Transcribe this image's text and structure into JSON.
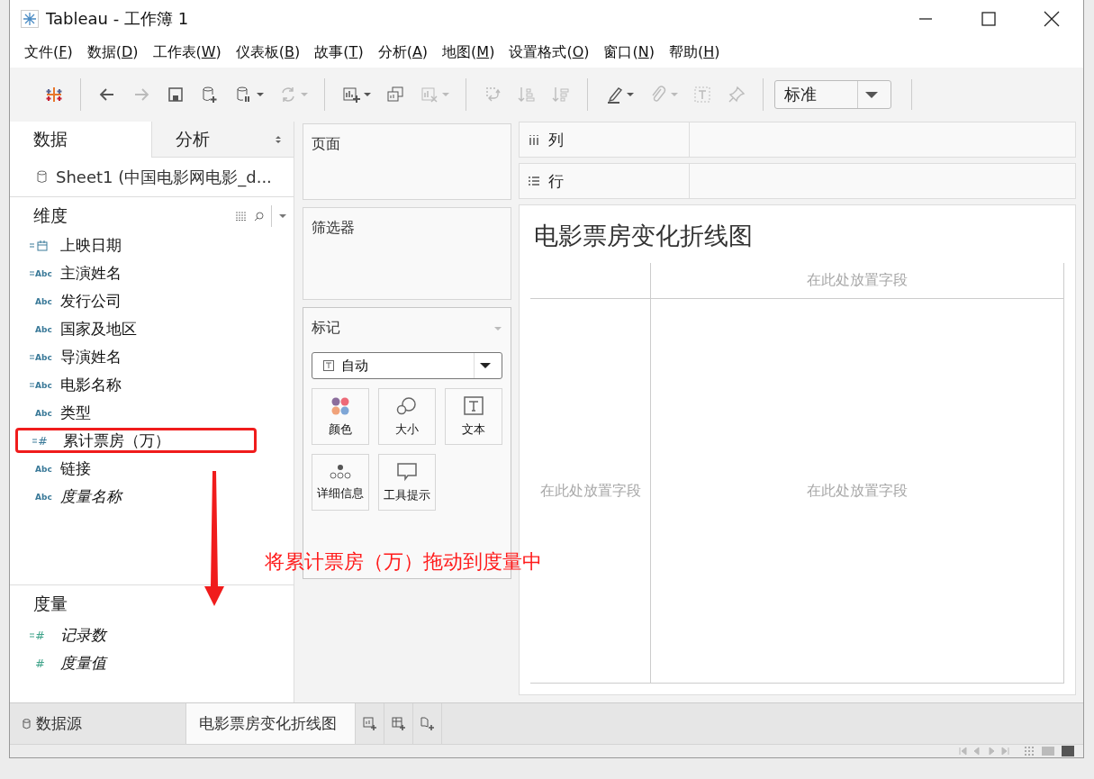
{
  "window": {
    "title": "Tableau - 工作簿 1"
  },
  "menu": [
    {
      "label": "文件(F)"
    },
    {
      "label": "数据(D)"
    },
    {
      "label": "工作表(W)"
    },
    {
      "label": "仪表板(B)"
    },
    {
      "label": "故事(T)"
    },
    {
      "label": "分析(A)"
    },
    {
      "label": "地图(M)"
    },
    {
      "label": "设置格式(O)"
    },
    {
      "label": "窗口(N)"
    },
    {
      "label": "帮助(H)"
    }
  ],
  "toolbar": {
    "groups": [
      [
        {
          "kind": "logo",
          "disabled": false,
          "dropdown": false
        }
      ],
      [
        {
          "kind": "undo",
          "disabled": false,
          "dropdown": false
        },
        {
          "kind": "redo",
          "disabled": true,
          "dropdown": false
        },
        {
          "kind": "save",
          "disabled": false,
          "dropdown": false
        },
        {
          "kind": "new-datasource",
          "disabled": false,
          "dropdown": false
        },
        {
          "kind": "pause-datasource",
          "disabled": false,
          "dropdown": true
        },
        {
          "kind": "refresh",
          "disabled": true,
          "dropdown": true
        }
      ],
      [
        {
          "kind": "new-sheet",
          "disabled": false,
          "dropdown": true
        },
        {
          "kind": "duplicate",
          "disabled": false,
          "dropdown": false
        },
        {
          "kind": "clear",
          "disabled": true,
          "dropdown": true
        }
      ],
      [
        {
          "kind": "swap",
          "disabled": true,
          "dropdown": false
        },
        {
          "kind": "sort-asc",
          "disabled": true,
          "dropdown": false
        },
        {
          "kind": "sort-desc",
          "disabled": true,
          "dropdown": false
        }
      ],
      [
        {
          "kind": "highlight",
          "disabled": false,
          "dropdown": true
        },
        {
          "kind": "group",
          "disabled": true,
          "dropdown": true
        },
        {
          "kind": "label",
          "disabled": true,
          "dropdown": false
        },
        {
          "kind": "pin",
          "disabled": true,
          "dropdown": false
        }
      ]
    ],
    "fit": "标准"
  },
  "side_tabs": [
    {
      "label": "数据",
      "selected": true
    },
    {
      "label": "分析",
      "selected": false
    }
  ],
  "datasource": "Sheet1 (中国电影网电影_d...",
  "dimensions": {
    "title": "维度",
    "fields": [
      {
        "name": "上映日期",
        "kind": "date",
        "derived": true,
        "generated": false,
        "highlighted": false
      },
      {
        "name": "主演姓名",
        "kind": "string",
        "type_label": "Abc",
        "derived": true,
        "generated": false,
        "highlighted": false
      },
      {
        "name": "发行公司",
        "kind": "string",
        "type_label": "Abc",
        "derived": false,
        "generated": false,
        "highlighted": false
      },
      {
        "name": "国家及地区",
        "kind": "string",
        "type_label": "Abc",
        "derived": false,
        "generated": false,
        "highlighted": false
      },
      {
        "name": "导演姓名",
        "kind": "string",
        "type_label": "Abc",
        "derived": true,
        "generated": false,
        "highlighted": false
      },
      {
        "name": "电影名称",
        "kind": "string",
        "type_label": "Abc",
        "derived": true,
        "generated": false,
        "highlighted": false
      },
      {
        "name": "类型",
        "kind": "string",
        "type_label": "Abc",
        "derived": false,
        "generated": false,
        "highlighted": false
      },
      {
        "name": "累计票房（万）",
        "kind": "number",
        "type_label": "#",
        "derived": true,
        "generated": false,
        "highlighted": true
      },
      {
        "name": "链接",
        "kind": "string",
        "type_label": "Abc",
        "derived": false,
        "generated": false,
        "highlighted": false
      },
      {
        "name": "度量名称",
        "kind": "string",
        "type_label": "Abc",
        "derived": false,
        "generated": true,
        "highlighted": false
      }
    ]
  },
  "measures": {
    "title": "度量",
    "fields": [
      {
        "name": "记录数",
        "kind": "measure",
        "type_label": "#",
        "derived": true,
        "generated": true,
        "highlighted": false
      },
      {
        "name": "度量值",
        "kind": "measure",
        "type_label": "#",
        "derived": false,
        "generated": true,
        "highlighted": false
      }
    ]
  },
  "annotation": "将累计票房（万）拖动到度量中",
  "shelves": {
    "pages": "页面",
    "filters": "筛选器",
    "marks": "标记",
    "mark_type": "自动",
    "mark_buttons": [
      {
        "label": "颜色",
        "kind": "color"
      },
      {
        "label": "大小",
        "kind": "size"
      },
      {
        "label": "文本",
        "kind": "text"
      },
      {
        "label": "详细信息",
        "kind": "detail"
      },
      {
        "label": "工具提示",
        "kind": "tooltip"
      }
    ],
    "columns": "列",
    "rows": "行"
  },
  "view": {
    "title": "电影票房变化折线图",
    "drop_top": "在此处放置字段",
    "drop_left": "在此处放置字段",
    "drop_center": "在此处放置字段"
  },
  "sheet_tabs": [
    {
      "label": "数据源",
      "kind": "datasource",
      "selected": false
    },
    {
      "label": "电影票房变化折线图",
      "kind": "sheet",
      "selected": true
    }
  ],
  "new_tab_buttons": [
    {
      "kind": "new-sheet"
    },
    {
      "kind": "new-dashboard"
    },
    {
      "kind": "new-story"
    }
  ]
}
